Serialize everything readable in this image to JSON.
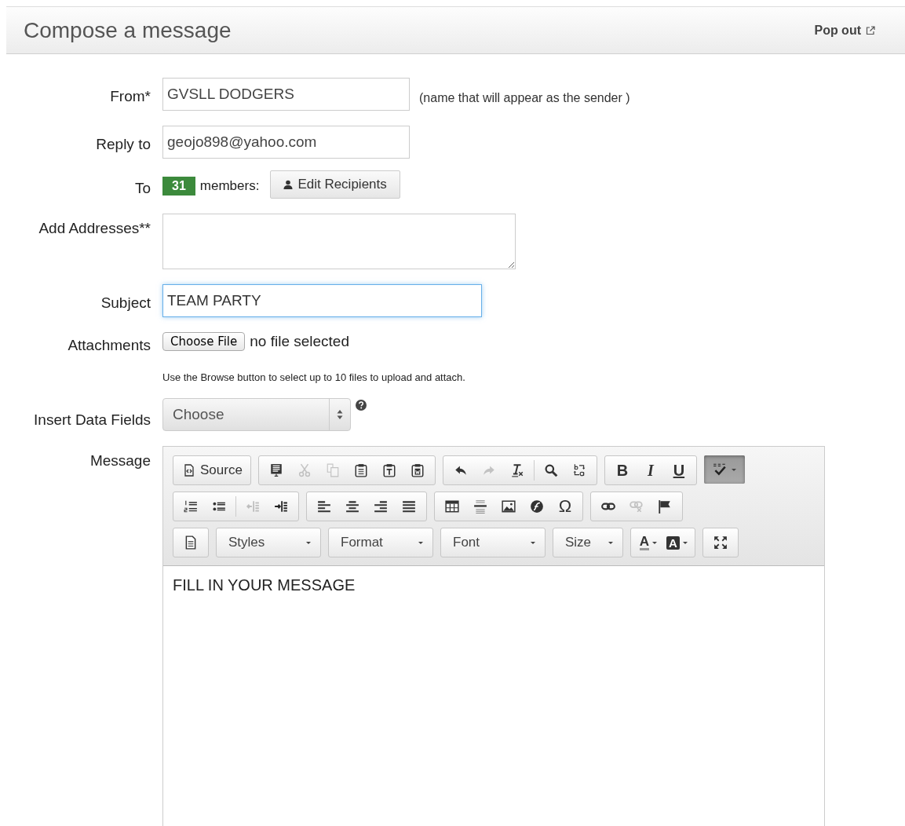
{
  "header": {
    "title": "Compose a message",
    "pop_out": "Pop out"
  },
  "fields": [
    {
      "kind": "text",
      "label": "From*",
      "value": "GVSLL DODGERS",
      "focused": false,
      "note": "(name that will appear as the sender )"
    },
    {
      "kind": "text",
      "label": "Reply to",
      "value": "geojo898@yahoo.com",
      "focused": false
    },
    {
      "kind": "recipients",
      "label": "To",
      "count": "31",
      "count_label": "members:",
      "button": "Edit Recipients"
    },
    {
      "kind": "textarea",
      "label": "Add Addresses**"
    },
    {
      "kind": "text",
      "label": "Subject",
      "value": "TEAM PARTY",
      "focused": true
    },
    {
      "kind": "file",
      "label": "Attachments",
      "button": "Choose File",
      "status": "no file selected",
      "hint": "Use the Browse button to select up to 10 files to upload and attach."
    },
    {
      "kind": "select",
      "label": "Insert Data Fields",
      "value": "Choose"
    }
  ],
  "message": {
    "label": "Message",
    "content": "FILL IN YOUR MESSAGE",
    "toolbar": [
      [
        {
          "items": [
            {
              "kind": "icon-label",
              "label": "Source",
              "disabled": false,
              "on": false
            }
          ]
        },
        {
          "items": [
            {
              "kind": "icon",
              "disabled": false,
              "on": false
            },
            {
              "kind": "icon",
              "disabled": true,
              "on": false
            },
            {
              "kind": "icon",
              "disabled": true,
              "on": false
            },
            {
              "kind": "icon",
              "disabled": false,
              "on": false
            },
            {
              "kind": "icon",
              "disabled": false,
              "on": false
            },
            {
              "kind": "icon",
              "disabled": false,
              "on": false
            }
          ]
        },
        {
          "items": [
            {
              "kind": "icon",
              "disabled": false,
              "on": false
            },
            {
              "kind": "icon",
              "disabled": true,
              "on": false
            },
            {
              "kind": "icon",
              "disabled": false,
              "on": false
            },
            {
              "kind": "separator"
            },
            {
              "kind": "icon",
              "disabled": false,
              "on": false
            },
            {
              "kind": "icon",
              "disabled": false,
              "on": false
            }
          ]
        },
        {
          "items": [
            {
              "kind": "glyph",
              "glyph": "B",
              "disabled": false,
              "on": false
            },
            {
              "kind": "glyph",
              "glyph": "I",
              "disabled": false,
              "on": false
            },
            {
              "kind": "glyph",
              "glyph": "U",
              "disabled": false,
              "on": false
            }
          ]
        },
        {
          "items": [
            {
              "kind": "icon-menu",
              "disabled": false,
              "on": true
            }
          ]
        }
      ],
      [
        {
          "items": [
            {
              "kind": "icon",
              "disabled": false,
              "on": false
            },
            {
              "kind": "icon",
              "disabled": false,
              "on": false
            },
            {
              "kind": "separator"
            },
            {
              "kind": "icon",
              "disabled": true,
              "on": false
            },
            {
              "kind": "icon",
              "disabled": false,
              "on": false
            }
          ]
        },
        {
          "items": [
            {
              "kind": "icon",
              "disabled": false,
              "on": false
            },
            {
              "kind": "icon",
              "disabled": false,
              "on": false
            },
            {
              "kind": "icon",
              "disabled": false,
              "on": false
            },
            {
              "kind": "icon",
              "disabled": false,
              "on": false
            }
          ]
        },
        {
          "items": [
            {
              "kind": "icon",
              "disabled": false,
              "on": false
            },
            {
              "kind": "icon",
              "disabled": false,
              "on": false
            },
            {
              "kind": "icon",
              "disabled": false,
              "on": false
            },
            {
              "kind": "icon",
              "disabled": false,
              "on": false
            },
            {
              "kind": "glyph",
              "glyph": "Ω",
              "disabled": false,
              "on": false
            }
          ]
        },
        {
          "items": [
            {
              "kind": "icon",
              "disabled": false,
              "on": false
            },
            {
              "kind": "icon",
              "disabled": true,
              "on": false
            },
            {
              "kind": "icon",
              "disabled": false,
              "on": false
            }
          ]
        }
      ],
      [
        {
          "items": [
            {
              "kind": "icon",
              "disabled": false,
              "on": false
            }
          ]
        },
        {
          "items": [
            {
              "kind": "combo",
              "label": "Styles"
            }
          ]
        },
        {
          "items": [
            {
              "kind": "combo",
              "label": "Format"
            }
          ]
        },
        {
          "items": [
            {
              "kind": "combo",
              "label": "Font"
            }
          ]
        },
        {
          "items": [
            {
              "kind": "combo",
              "label": "Size"
            }
          ]
        },
        {
          "items": [
            {
              "kind": "glyph-menu",
              "glyph": "A",
              "boxed": false
            },
            {
              "kind": "glyph-menu",
              "glyph": "A",
              "boxed": true
            }
          ]
        },
        {
          "items": [
            {
              "kind": "icon",
              "disabled": false,
              "on": false
            }
          ]
        }
      ]
    ]
  }
}
